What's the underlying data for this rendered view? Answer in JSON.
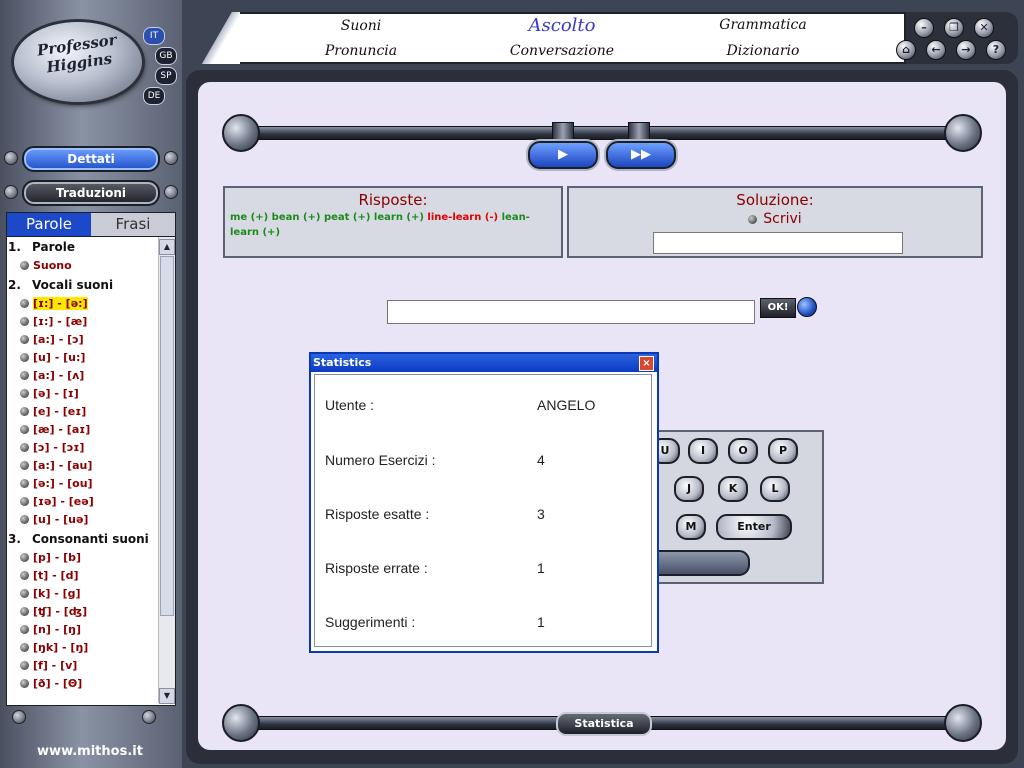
{
  "app": {
    "logo_text": "Professor Higgins",
    "languages": [
      "IT",
      "GB",
      "SP",
      "DE"
    ],
    "active_language": "IT",
    "footer": "www.mithos.it"
  },
  "sidebar": {
    "buttons": {
      "dettati": "Dettati",
      "traduzioni": "Traduzioni"
    },
    "tabs": {
      "parole": "Parole",
      "frasi": "Frasi"
    },
    "sections": [
      {
        "num": "1.",
        "title": "Parole",
        "items": [
          "Suono"
        ]
      },
      {
        "num": "2.",
        "title": "Vocali suoni",
        "items": [
          "[ɪ:] - [ə:]",
          "[ɪ:] - [æ]",
          "[a:] - [ɔ]",
          "[u] - [u:]",
          "[a:] - [ʌ]",
          "[ə] - [ɪ]",
          "[e] - [eɪ]",
          "[æ] - [aɪ]",
          "[ɔ] - [ɔɪ]",
          "[a:] - [au]",
          "[ə:] - [ou]",
          "[ɪə] - [eə]",
          "[u] - [uə]"
        ]
      },
      {
        "num": "3.",
        "title": "Consonanti suoni",
        "items": [
          "[p] - [b]",
          "[t] - [d]",
          "[k] - [g]",
          "[ʧ] - [ʤ]",
          "[n] - [ŋ]",
          "[ŋk] - [ŋ]",
          "[f] - [v]",
          "[ð] - [Θ]"
        ]
      }
    ],
    "selected_item": "[ɪ:] - [ə:]"
  },
  "menu": {
    "suoni": "Suoni",
    "ascolto": "Ascolto",
    "grammatica": "Grammatica",
    "pronuncia": "Pronuncia",
    "conversazione": "Conversazione",
    "dizionario": "Dizionario",
    "active": "Ascolto"
  },
  "player": {
    "play_symbol": "▶",
    "forward_symbol": "▶▶"
  },
  "risposte": {
    "title": "Risposte:",
    "parts": [
      {
        "text": "me (+) bean (+) peat (+) learn (+) ",
        "color": "#1b8a1b"
      },
      {
        "text": "line-learn (-)",
        "color": "#e00000"
      },
      {
        "text": " lean-learn (+)",
        "color": "#1b8a1b"
      }
    ]
  },
  "soluzione": {
    "title": "Soluzione:",
    "option": "Scrivi",
    "value": ""
  },
  "answer": {
    "value": "",
    "ok_label": "OK!"
  },
  "keyboard": {
    "row1": [
      "U",
      "I",
      "O",
      "P"
    ],
    "row2": [
      "J",
      "K",
      "L"
    ],
    "row3": [
      "M"
    ],
    "enter_label": "Enter"
  },
  "statistica_label": "Statistica",
  "dialog": {
    "title": "Statistics",
    "close": "×",
    "rows": [
      {
        "label": "Utente :",
        "value": "ANGELO"
      },
      {
        "label": "Numero Esercizi :",
        "value": "4"
      },
      {
        "label": "Risposte esatte :",
        "value": "3"
      },
      {
        "label": "Risposte errate :",
        "value": "1"
      },
      {
        "label": "Suggerimenti :",
        "value": "1"
      }
    ]
  }
}
